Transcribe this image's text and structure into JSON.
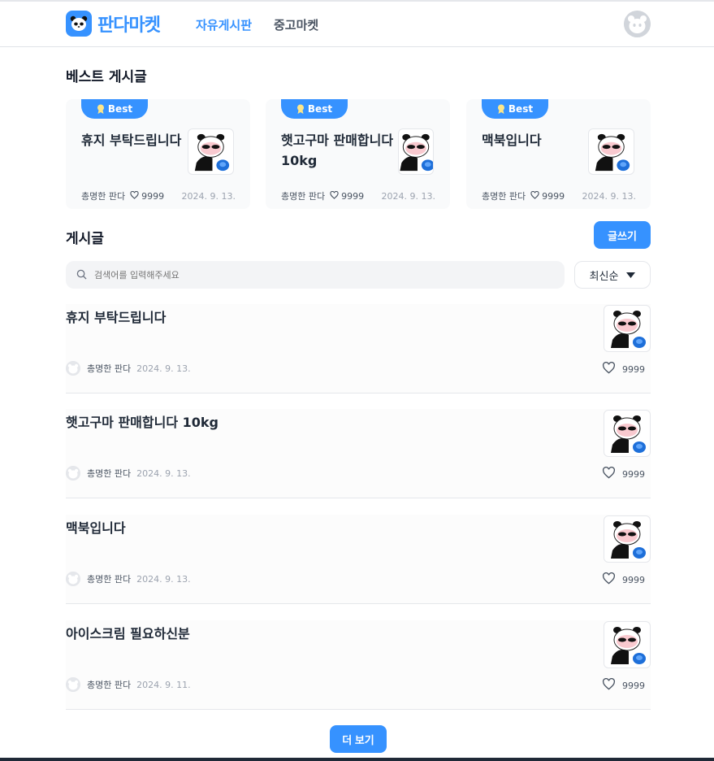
{
  "header": {
    "logo_text": "판다마켓",
    "nav": [
      "자유게시판",
      "중고마켓"
    ]
  },
  "best": {
    "title": "베스트 게시글",
    "badge_label": "Best",
    "cards": [
      {
        "title": "휴지 부탁드립니다",
        "author": "총명한 판다",
        "likes": "9999",
        "date": "2024. 9. 13."
      },
      {
        "title": "햇고구마 판매합니다 10kg",
        "author": "총명한 판다",
        "likes": "9999",
        "date": "2024. 9. 13."
      },
      {
        "title": "맥북입니다",
        "author": "총명한 판다",
        "likes": "9999",
        "date": "2024. 9. 13."
      }
    ]
  },
  "posts": {
    "title": "게시글",
    "write_label": "글쓰기",
    "search_placeholder": "검색어를 입력해주세요",
    "sort_label": "최신순",
    "items": [
      {
        "title": "휴지 부탁드립니다",
        "author": "총명한 판다",
        "date": "2024. 9. 13.",
        "likes": "9999"
      },
      {
        "title": "햇고구마 판매합니다 10kg",
        "author": "총명한 판다",
        "date": "2024. 9. 13.",
        "likes": "9999"
      },
      {
        "title": "맥북입니다",
        "author": "총명한 판다",
        "date": "2024. 9. 13.",
        "likes": "9999"
      },
      {
        "title": "아이스크림 필요하신분",
        "author": "총명한 판다",
        "date": "2024. 9. 11.",
        "likes": "9999"
      }
    ],
    "more_label": "더 보기"
  },
  "colors": {
    "accent": "#3692ff",
    "text": "#1f2937",
    "muted": "#9ca3af"
  },
  "icons": [
    "panda-logo-icon",
    "profile-avatar-icon",
    "medal-icon",
    "heart-icon",
    "search-icon",
    "caret-down-icon",
    "panda-thumbnail"
  ]
}
